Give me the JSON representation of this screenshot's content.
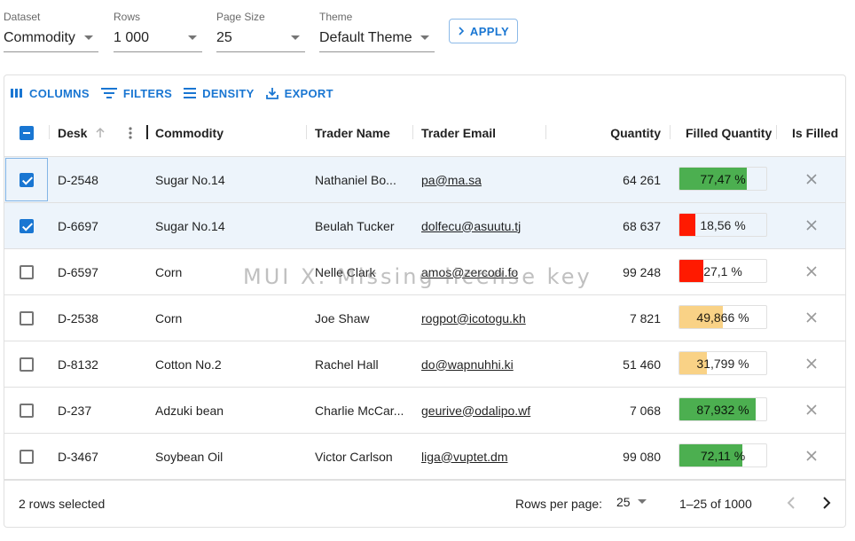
{
  "controls": {
    "dataset": {
      "label": "Dataset",
      "value": "Commodity"
    },
    "rows": {
      "label": "Rows",
      "value": "1 000"
    },
    "page_size": {
      "label": "Page Size",
      "value": "25"
    },
    "theme": {
      "label": "Theme",
      "value": "Default Theme"
    },
    "apply_label": "APPLY"
  },
  "grid_toolbar": {
    "columns": "COLUMNS",
    "filters": "FILTERS",
    "density": "DENSITY",
    "export": "EXPORT"
  },
  "columns": {
    "desk": "Desk",
    "commodity": "Commodity",
    "trader_name": "Trader Name",
    "trader_email": "Trader Email",
    "quantity": "Quantity",
    "filled_quantity": "Filled Quantity",
    "is_filled": "Is Filled"
  },
  "rows": [
    {
      "selected": true,
      "desk": "D-2548",
      "commodity": "Sugar No.14",
      "trader": "Nathaniel Bo...",
      "email": "pa@ma.sa",
      "quantity": "64 261",
      "filled": 0.7747,
      "filled_label": "77,47 %",
      "bar_color": "#4caf50",
      "is_filled": "✕"
    },
    {
      "selected": true,
      "desk": "D-6697",
      "commodity": "Sugar No.14",
      "trader": "Beulah Tucker",
      "email": "dolfecu@asuutu.tj",
      "quantity": "68 637",
      "filled": 0.1856,
      "filled_label": "18,56 %",
      "bar_color": "#ff1a00",
      "is_filled": "✕"
    },
    {
      "selected": false,
      "desk": "D-6597",
      "commodity": "Corn",
      "trader": "Nelle Clark",
      "email": "amos@zercodi.fo",
      "quantity": "99 248",
      "filled": 0.271,
      "filled_label": "27,1 %",
      "bar_color": "#ff1a00",
      "is_filled": "✕"
    },
    {
      "selected": false,
      "desk": "D-2538",
      "commodity": "Corn",
      "trader": "Joe Shaw",
      "email": "rogpot@icotogu.kh",
      "quantity": "7 821",
      "filled": 0.49866,
      "filled_label": "49,866 %",
      "bar_color": "#f9d286",
      "is_filled": "✕"
    },
    {
      "selected": false,
      "desk": "D-8132",
      "commodity": "Cotton No.2",
      "trader": "Rachel Hall",
      "email": "do@wapnuhhi.ki",
      "quantity": "51 460",
      "filled": 0.31799,
      "filled_label": "31,799 %",
      "bar_color": "#f9d286",
      "is_filled": "✕"
    },
    {
      "selected": false,
      "desk": "D-237",
      "commodity": "Adzuki bean",
      "trader": "Charlie McCar...",
      "email": "geurive@odalipo.wf",
      "quantity": "7 068",
      "filled": 0.87932,
      "filled_label": "87,932 %",
      "bar_color": "#4caf50",
      "is_filled": "✕"
    },
    {
      "selected": false,
      "desk": "D-3467",
      "commodity": "Soybean Oil",
      "trader": "Victor Carlson",
      "email": "liga@vuptet.dm",
      "quantity": "99 080",
      "filled": 0.7211,
      "filled_label": "72,11 %",
      "bar_color": "#4caf50",
      "is_filled": "✕"
    }
  ],
  "footer": {
    "selected_text": "2 rows selected",
    "rows_per_page_label": "Rows per page:",
    "rows_per_page_value": "25",
    "range": "1–25 of 1000"
  },
  "watermark": "MUI X: Missing license key",
  "colors": {
    "primary": "#1976d2",
    "green": "#4caf50",
    "red": "#ff1a00",
    "yellow": "#f9d286"
  }
}
